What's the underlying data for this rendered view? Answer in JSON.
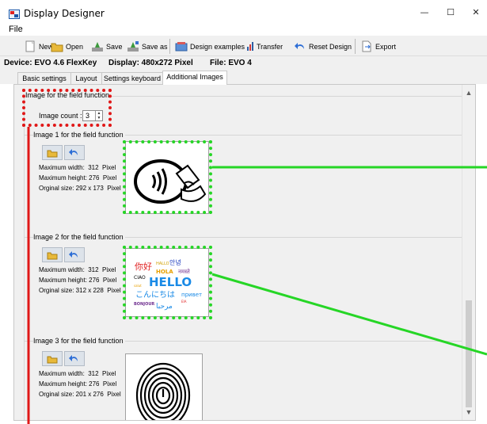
{
  "window": {
    "title": "Display Designer",
    "buttons": [
      "—",
      "☐",
      "✕"
    ]
  },
  "menu": {
    "file": "File"
  },
  "toolbar": {
    "items": [
      {
        "label": "New",
        "icon": "new-document-icon"
      },
      {
        "label": "Open",
        "icon": "folder-open-icon"
      },
      {
        "label": "Save",
        "icon": "save-icon"
      },
      {
        "label": "Save as",
        "icon": "save-as-icon"
      },
      {
        "label": "Design examples",
        "icon": "design-examples-icon"
      },
      {
        "label": "Transfer",
        "icon": "transfer-icon"
      },
      {
        "label": "Reset Design",
        "icon": "reset-icon"
      },
      {
        "label": "Export",
        "icon": "export-icon"
      }
    ]
  },
  "info": {
    "device": "Device: EVO 4.6 FlexKey",
    "display": "Display: 480x272 Pixel",
    "file": "File: EVO 4"
  },
  "tabs": [
    "Basic settings",
    "Layout",
    "Settings keyboard",
    "Additional Images"
  ],
  "active_tab": 3,
  "section": {
    "title": "Image for the field function",
    "count_label": "Image count :",
    "count_value": "3"
  },
  "images": [
    {
      "title": "Image 1 for the field function",
      "max_width": "Maximum width:  312  Pixel",
      "max_height": "Maximum height: 276  Pixel",
      "orig_size": "Orginal size: 292 x 173  Pixel",
      "thumb": "contactless-payment-icon"
    },
    {
      "title": "Image 2 for the field function",
      "max_width": "Maximum width:  312  Pixel",
      "max_height": "Maximum height: 276  Pixel",
      "orig_size": "Orginal size: 312 x 228  Pixel",
      "thumb": "hello-languages-image",
      "words": [
        "你好",
        "HALLO",
        "안녕",
        "HOLA",
        "नमस्ते",
        "CIAO",
        "HELLO",
        "salut",
        "こんにちは",
        "привет",
        "BONJOUR",
        "مرحبا",
        "ΕΙΑ"
      ]
    },
    {
      "title": "Image 3 for the field function",
      "max_width": "Maximum width:  312  Pixel",
      "max_height": "Maximum height: 276  Pixel",
      "orig_size": "Orginal size: 201 x 276  Pixel",
      "thumb": "fingerprint-image"
    }
  ],
  "colors": {
    "highlight_red": "#e01818",
    "highlight_green": "#26d626",
    "toolbar_bg": "#f0f0f0"
  }
}
